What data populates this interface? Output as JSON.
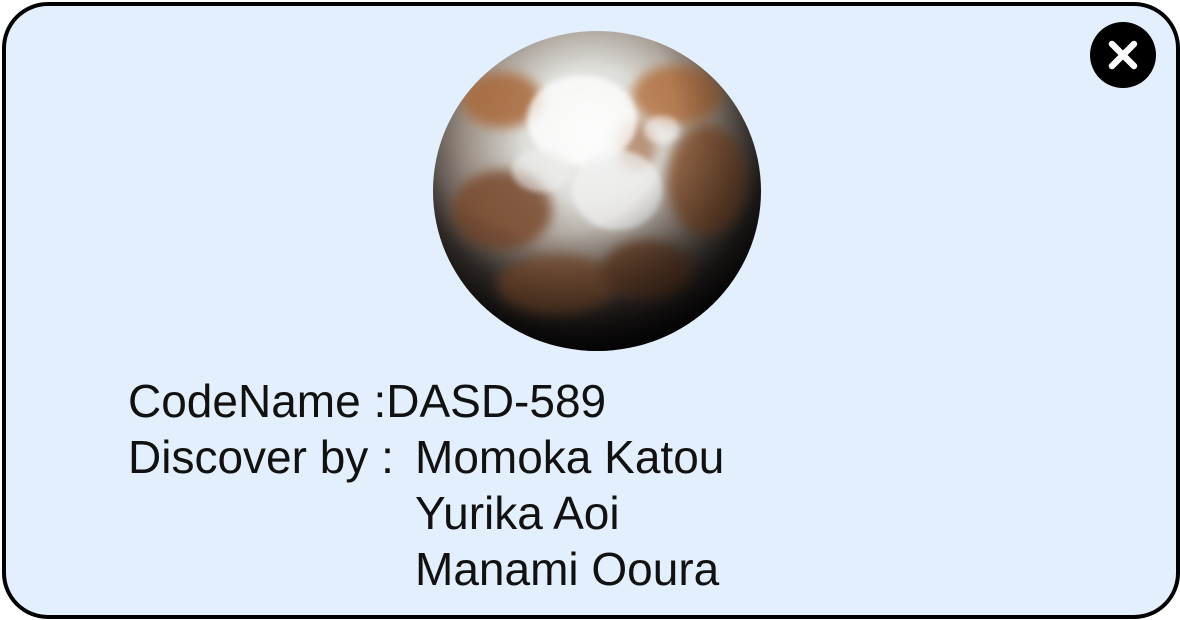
{
  "dialog": {
    "close_icon": "close-icon",
    "image": {
      "subject": "planet",
      "colors": {
        "ice": "#f4f4f2",
        "rust": "#a8673a",
        "dark": "#0e0e0e",
        "background": "#e3effd"
      }
    },
    "codename": {
      "label": "CodeName : ",
      "value": "DASD-589"
    },
    "discovered": {
      "label": "Discover by : ",
      "names": [
        "Momoka Katou",
        "Yurika Aoi",
        "Manami Ooura"
      ]
    }
  }
}
